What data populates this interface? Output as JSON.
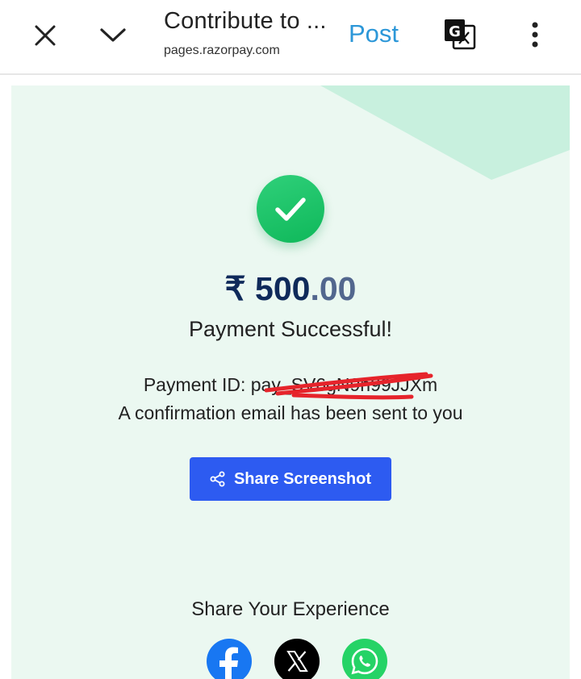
{
  "browser": {
    "title": "Contribute to ...",
    "url": "pages.razorpay.com",
    "post_label": "Post",
    "icons": [
      "close-icon",
      "chevron-down-icon",
      "translate-icon",
      "more-vert-icon"
    ]
  },
  "payment": {
    "currency_symbol": "₹",
    "amount_whole": "500",
    "amount_decimal": ".00",
    "status": "Payment Successful!",
    "payment_id_label": "Payment ID: pay_SV6gN9n99JJXm",
    "confirmation": "A confirmation email has been sent to you",
    "share_button_label": "Share Screenshot"
  },
  "share": {
    "heading": "Share Your Experience",
    "icons": [
      "facebook-icon",
      "x-icon",
      "whatsapp-icon"
    ]
  },
  "colors": {
    "page_bg": "#ebf8f1",
    "accent": "#2d5bf1",
    "success": "#1cc46a",
    "link": "#2c97d8"
  }
}
